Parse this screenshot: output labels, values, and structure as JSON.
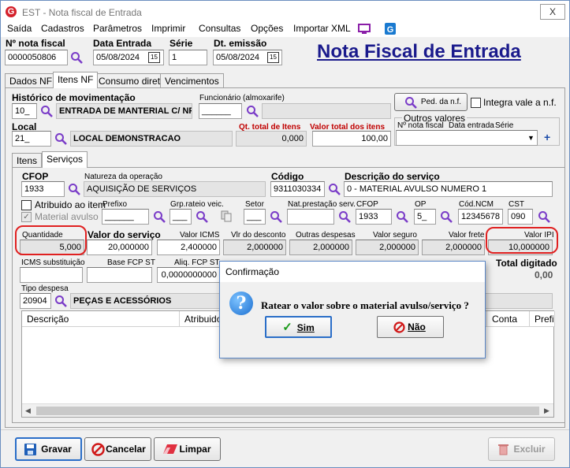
{
  "window": {
    "title": "EST - Nota fiscal de Entrada",
    "close": "X",
    "logo": "G"
  },
  "menu": [
    "Saída",
    "Cadastros",
    "Parâmetros",
    "Imprimir",
    "Consultas",
    "Opções",
    "Importar XML"
  ],
  "header": {
    "nota_label": "Nº nota fiscal",
    "nota_value": "0000050806",
    "data_entrada_label": "Data Entrada",
    "data_entrada_value": "05/08/2024",
    "serie_label": "Série",
    "serie_value": "1",
    "emissao_label": "Dt. emissão",
    "emissao_value": "05/08/2024",
    "cal_icon": "15",
    "big_title": "Nota Fiscal de Entrada"
  },
  "main_tabs": [
    "Dados NF",
    "Itens NF",
    "Consumo direto",
    "Vencimentos"
  ],
  "mov": {
    "hist_label": "Histórico de movimentação",
    "hist_code": "10_",
    "hist_desc": "ENTRADA DE MANTERIAL C/ NF",
    "func_label": "Funcionário (almoxarife)",
    "func_code": "______",
    "func_desc": "",
    "ped_button": "Ped. da n.f.",
    "integra_label": "Integra vale a n.f.",
    "local_label": "Local",
    "local_code": "21_",
    "local_desc": "LOCAL DEMONSTRACAO",
    "qt_total_label": "Qt. total de Itens",
    "qt_total_value": "0,000",
    "valor_total_label": "Valor total dos itens",
    "valor_total_value": "100,00",
    "outros_label": "Outros valores",
    "outros_cols": [
      "Nº nota fiscal",
      "Data entrada",
      "Série"
    ],
    "plus": "+"
  },
  "sub_tabs": [
    "Itens",
    "Serviços"
  ],
  "serv": {
    "cfop_label": "CFOP",
    "cfop_value": "1933",
    "nat_label": "Natureza da operação",
    "nat_value": "AQUISIÇÃO DE SERVIÇOS",
    "codigo_label": "Código",
    "codigo_value": "9311030334",
    "desc_label": "Descrição do serviço",
    "desc_value": "0 - MATERIAL AVULSO NUMERO 1",
    "atribuido_label": "Atribuido ao item",
    "material_label": "Material avulso",
    "prefixo_label": "Prefixo",
    "prefixo_value": "______",
    "grp_label": "Grp.rateio veic.",
    "grp_value": "___",
    "setor_label": "Setor",
    "setor_value": "___",
    "natprest_label": "Nat.prestação serv.",
    "natprest_value": "",
    "cfop2_label": "CFOP",
    "cfop2_value": "1933",
    "op_label": "OP",
    "op_value": "5_",
    "ncm_label": "Cód.NCM",
    "ncm_value": "12345678",
    "cst_label": "CST",
    "cst_value": "090",
    "qtd_label": "Quantidade",
    "qtd_value": "5,000",
    "valserv_label": "Valor do serviço",
    "valserv_value": "20,000000",
    "icms_label": "Valor ICMS",
    "icms_value": "2,400000",
    "desconto_label": "Vlr do desconto",
    "desconto_value": "2,000000",
    "outras_label": "Outras despesas",
    "outras_value": "2,000000",
    "seguro_label": "Valor seguro",
    "seguro_value": "2,000000",
    "frete_label": "Valor frete",
    "frete_value": "2,000000",
    "ipi_label": "Valor IPI",
    "ipi_value": "10,000000",
    "icmssub_label": "ICMS substituição",
    "icmssub_value": "",
    "basefcp_label": "Base FCP ST",
    "basefcp_value": "",
    "aliqfcp_label": "Aliq. FCP ST",
    "aliqfcp_value": "0,0000000000",
    "total_label": "Total digitado",
    "total_value": "0,00",
    "tipo_label": "Tipo despesa",
    "tipo_code": "20904",
    "tipo_desc": "PEÇAS E ACESSÓRIOS"
  },
  "grid": {
    "columns": [
      "Descrição",
      "Atribuido",
      "Conta",
      "Prefi"
    ]
  },
  "dialog": {
    "title": "Confirmação",
    "message": "Ratear o valor sobre o material avulso/serviço ?",
    "yes": "Sim",
    "no": "Não",
    "icon": "?"
  },
  "bottom": {
    "gravar": "Gravar",
    "cancelar": "Cancelar",
    "limpar": "Limpar",
    "excluir": "Excluir"
  }
}
